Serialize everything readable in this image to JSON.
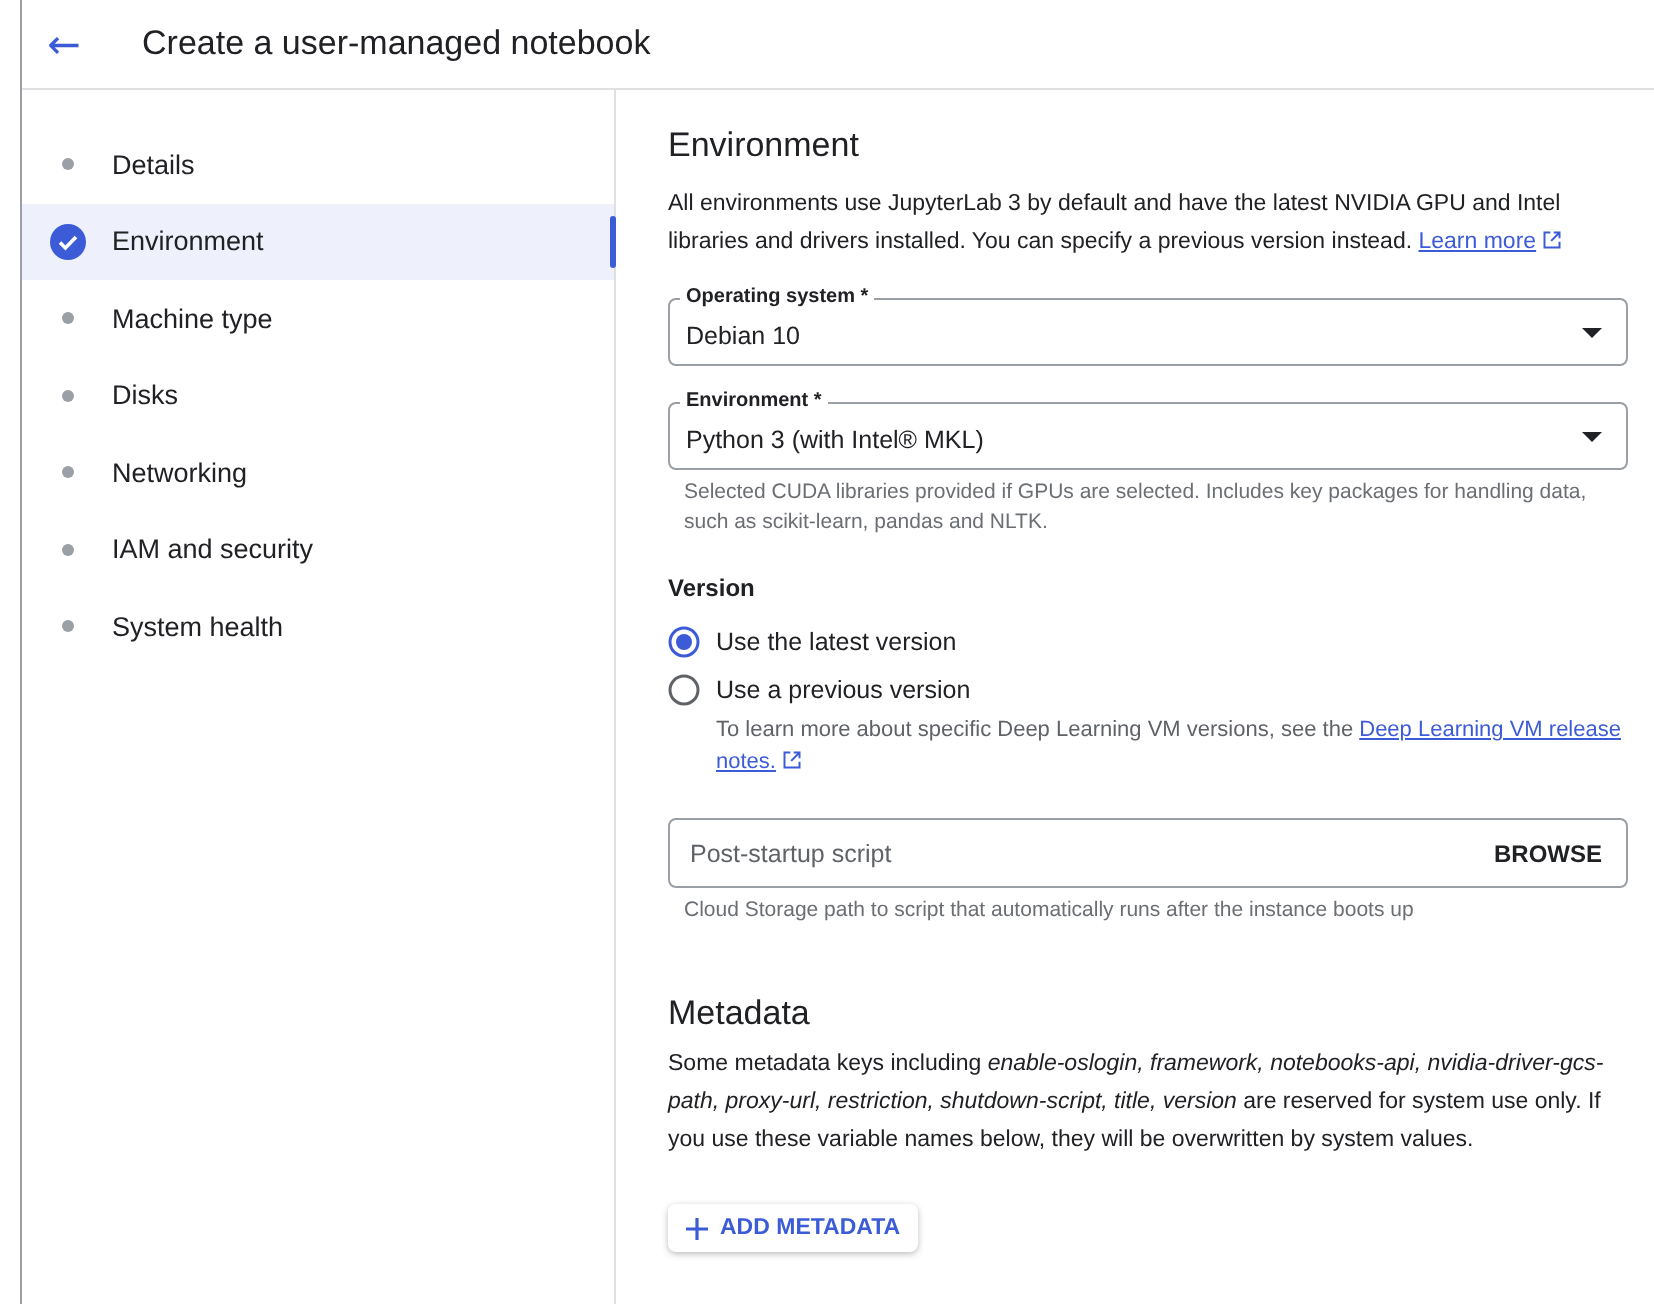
{
  "header": {
    "back": "←",
    "title": "Create a user-managed notebook"
  },
  "steps": [
    {
      "label": "Details",
      "selected": false
    },
    {
      "label": "Environment",
      "selected": true
    },
    {
      "label": "Machine type",
      "selected": false
    },
    {
      "label": "Disks",
      "selected": false
    },
    {
      "label": "Networking",
      "selected": false
    },
    {
      "label": "IAM and security",
      "selected": false
    },
    {
      "label": "System health",
      "selected": false
    }
  ],
  "section": {
    "title": "Environment",
    "description": "All environments use JupyterLab 3 by default and have the latest NVIDIA GPU and Intel libraries and drivers installed. You can specify a previous version instead.",
    "link": "Learn more"
  },
  "selects": [
    {
      "label": "Operating system *",
      "value": "Debian 10"
    },
    {
      "label": "Environment *",
      "value": "Python 3 (with Intel® MKL)",
      "hint": "Selected CUDA libraries provided if GPUs are selected. Includes key packages for handling data, such as scikit-learn, pandas and NLTK."
    }
  ],
  "version": {
    "title": "Version",
    "options": [
      {
        "label": "Use the latest version",
        "selected": true
      },
      {
        "label": "Use a previous version",
        "selected": false,
        "note": "To learn more about specific Deep Learning VM versions, see the",
        "link_parts": [
          "Deep Learning VM release",
          "notes."
        ]
      }
    ]
  },
  "script_field": {
    "placeholder": "Post-startup script",
    "button": "BROWSE",
    "hint": "Cloud Storage path to script that automatically runs after the instance boots up"
  },
  "metadata": {
    "title": "Metadata",
    "description": "Some metadata keys including *enable-oslogin, framework, notebooks-api, nvidia-driver-gcs-path, proxy-url, restriction, shutdown-script, title, version* are reserved for system use only. If you use these variable names below, they will be overwritten by system values.",
    "button": "ADD METADATA"
  }
}
